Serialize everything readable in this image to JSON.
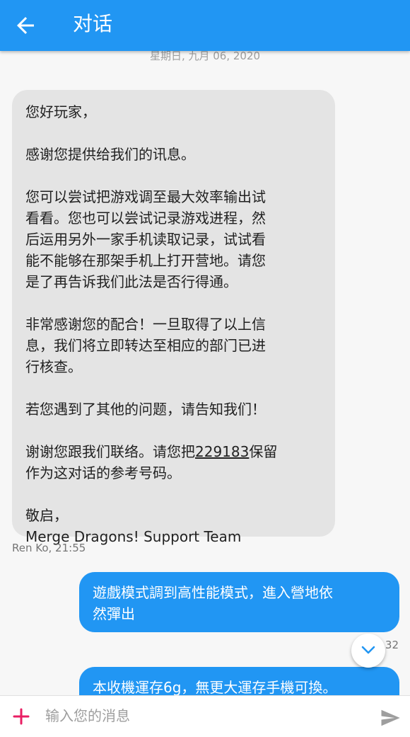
{
  "header": {
    "title": "对话",
    "back_icon": "arrow-left-icon"
  },
  "date_separator": "星期日, 九月 06, 2020",
  "messages": [
    {
      "direction": "incoming",
      "paragraphs": [
        "您好玩家，",
        "感谢您提供给我们的讯息。",
        "您可以尝试把游戏调至最大效率输出试\n看看。您也可以尝试记录游戏进程，然\n后运用另外一家手机读取记录，试试看\n能不能够在那架手机上打开营地。请您\n是了再告诉我们此法是否行得通。",
        "非常感谢您的配合！一旦取得了以上信\n息，我们将立即转达至相应的部门已进\n行核查。",
        "若您遇到了其他的问题，请告知我们！"
      ],
      "ref_prefix": "谢谢您跟我们联络。请您把",
      "ref_number": "229183",
      "ref_suffix": "保留\n作为这对话的参考号码。",
      "closing": "敬启，\nMerge Dragons! Support Team",
      "meta": "Ren Ko, 21:55"
    },
    {
      "direction": "outgoing",
      "text": "遊戲模式調到高性能模式，進入營地依\n然彈出",
      "meta": "32"
    },
    {
      "direction": "outgoing",
      "text": "本收機運存6g，無更大運存手機可換。"
    }
  ],
  "composer": {
    "placeholder": "输入您的消息",
    "value": "",
    "add_icon": "plus-icon",
    "send_icon": "send-icon"
  },
  "scroll_button_icon": "chevron-down-icon",
  "colors": {
    "primary": "#2196f3",
    "incoming_bubble": "#e4e4e4",
    "accent_plus": "#e91e63",
    "background": "#f7f7f7"
  }
}
